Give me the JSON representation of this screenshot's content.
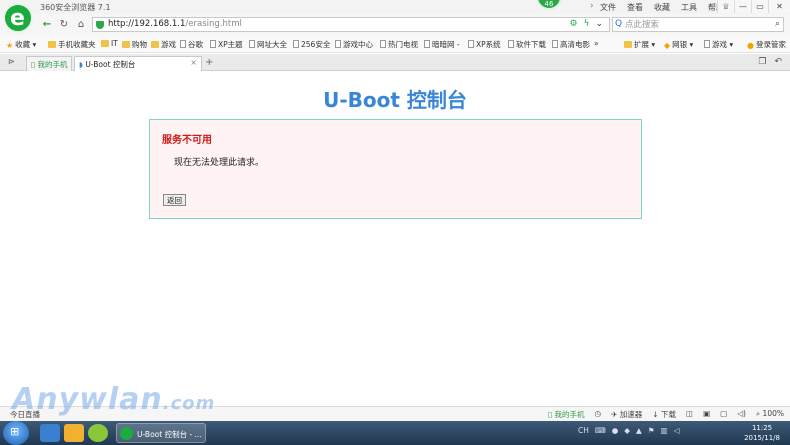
{
  "browser": {
    "app_title": "360安全浏览器 7.1",
    "badge": "46",
    "menu": [
      "文件",
      "查看",
      "收藏",
      "工具",
      "帮助"
    ],
    "window_buttons": {
      "minimize": "—",
      "restore": "▭",
      "close": "✕"
    }
  },
  "address_bar": {
    "url_host": "http://192.168.1.1",
    "url_path": "/erasing.html",
    "search_placeholder": "点此搜索"
  },
  "bookmarks": {
    "favorites_label": "收藏",
    "items": [
      "手机收藏夹",
      "IT",
      "购物",
      "游戏",
      "谷歌",
      "XP主题",
      "网址大全",
      "256安全",
      "游戏中心",
      "热门电视",
      "暗暗网 -",
      "XP系统",
      "软件下载",
      "高清电影"
    ],
    "more": "»",
    "right_items": [
      "扩展",
      "网银",
      "游戏",
      "登录管家"
    ]
  },
  "tabs": {
    "items": [
      {
        "label": "我的手机"
      },
      {
        "label": "U-Boot 控制台"
      }
    ],
    "close_symbol": "×",
    "new_tab_symbol": "+"
  },
  "page": {
    "heading": "U-Boot 控制台",
    "error_title": "服务不可用",
    "error_message": "现在无法处理此请求。",
    "back_button": "返回"
  },
  "status_bar": {
    "left": "今日直播",
    "items": [
      "我的手机",
      "加速器",
      "下载",
      "100%"
    ]
  },
  "taskbar": {
    "window_label": "U-Boot 控制台 - ...",
    "tray_lang": "CH",
    "time": "11:25",
    "date": "2015/11/8"
  },
  "watermark": "Anywlan",
  "watermark_suffix": ".com",
  "colors": {
    "heading": "#3a86d6",
    "error_title": "#d11a1a",
    "box_border": "#7ad7c8",
    "box_bg": "#fff3f3",
    "brand_green": "#1bab3e"
  }
}
